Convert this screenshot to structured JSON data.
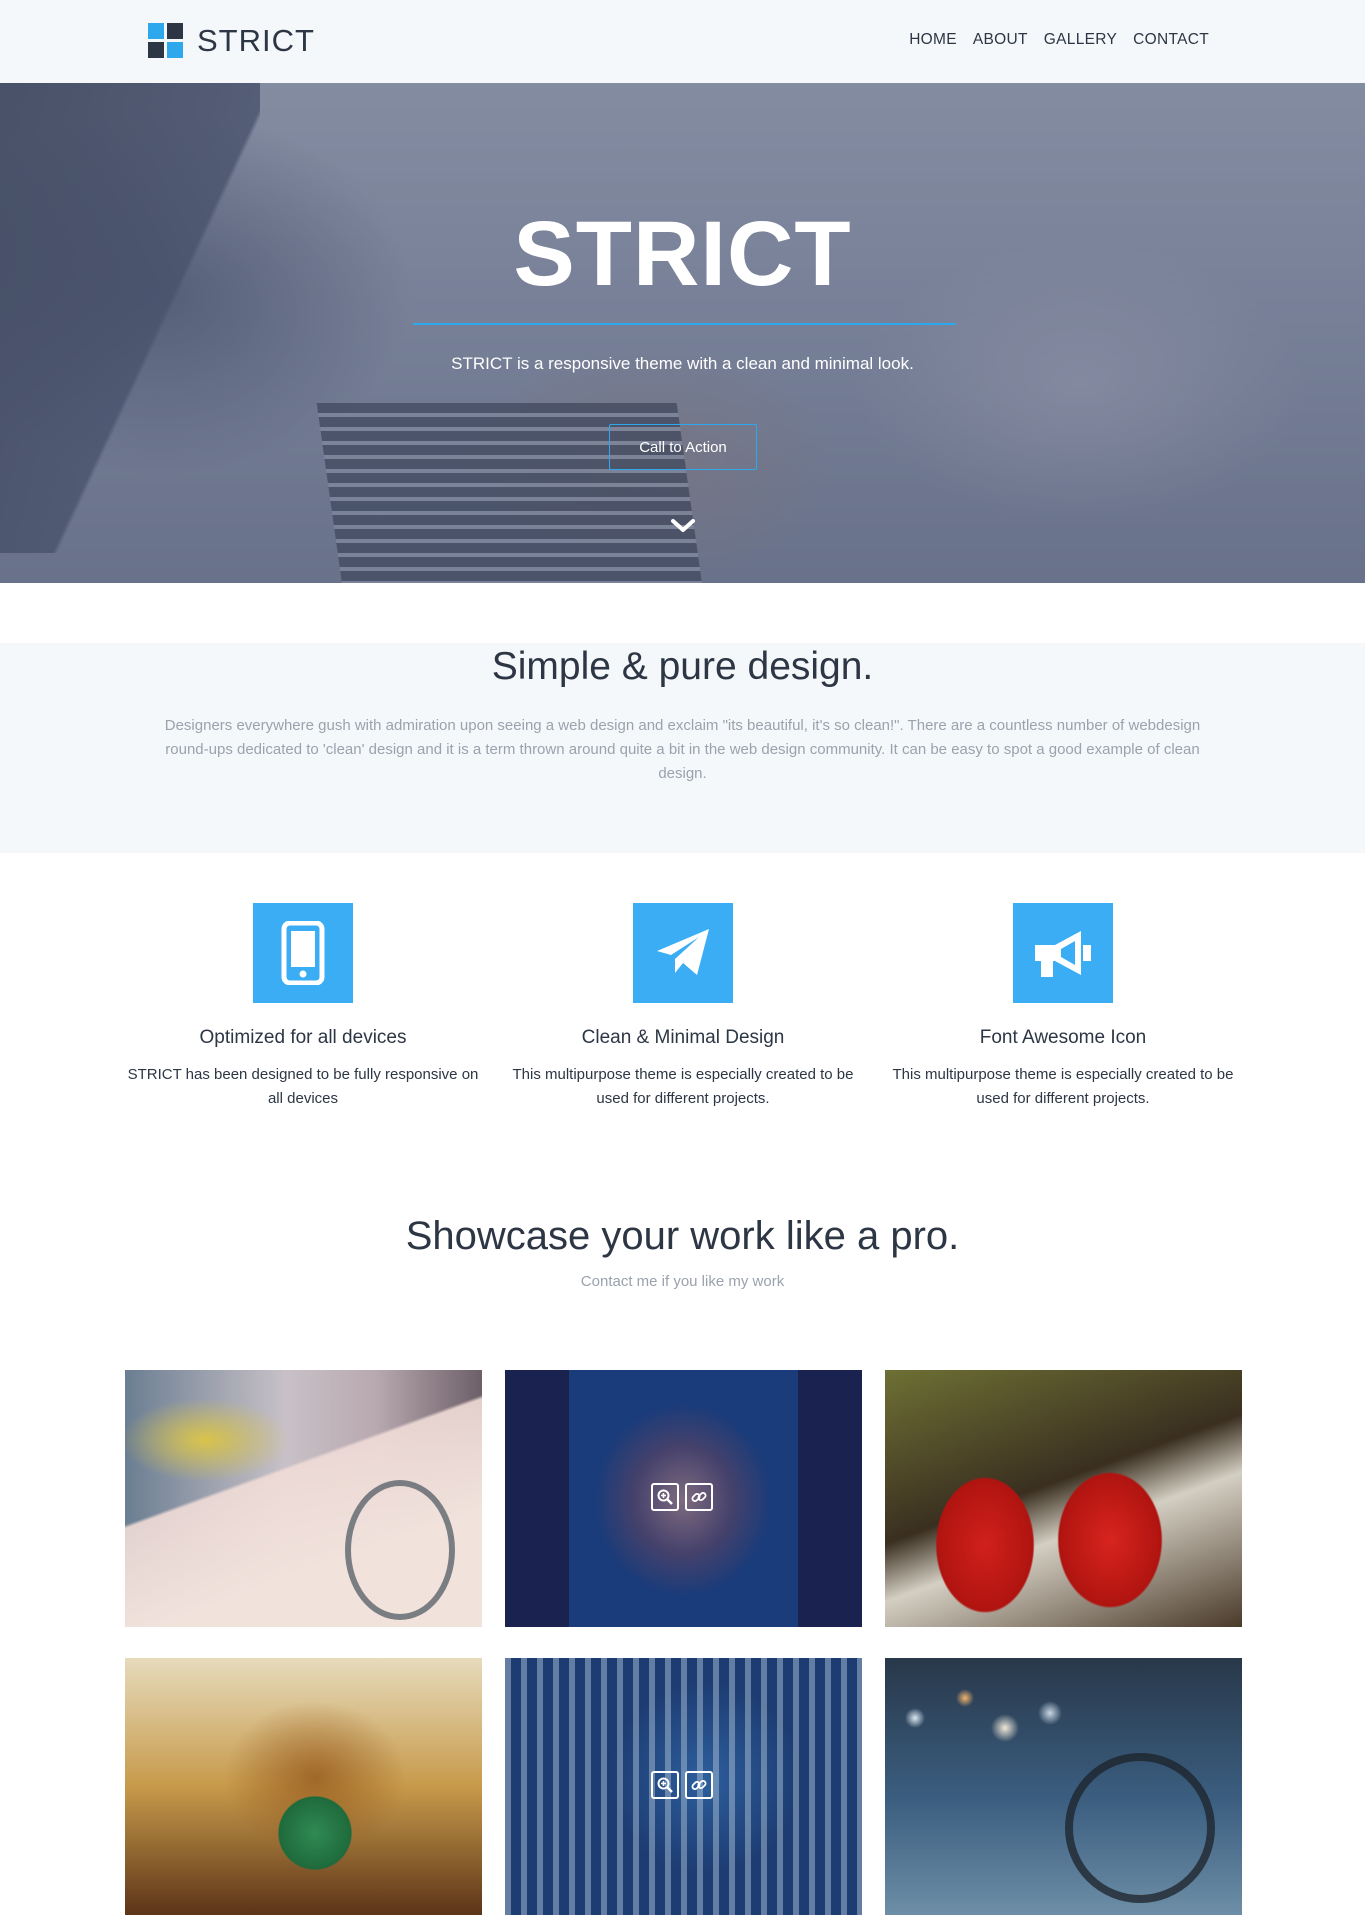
{
  "brand": {
    "name": "STRICT"
  },
  "nav": {
    "items": [
      {
        "label": "HOME"
      },
      {
        "label": "ABOUT"
      },
      {
        "label": "GALLERY"
      },
      {
        "label": "CONTACT"
      }
    ]
  },
  "hero": {
    "title": "STRICT",
    "subtitle": "STRICT is a responsive theme with a clean and minimal look.",
    "cta_label": "Call to Action"
  },
  "intro": {
    "heading": "Simple & pure design.",
    "body": "Designers everywhere gush with admiration upon seeing a web design and exclaim \"its beautiful, it's so clean!\". There are a countless number of webdesign round-ups dedicated to 'clean' design and it is a term thrown around quite a bit in the web design community. It can be easy to spot a good example of clean design."
  },
  "features": [
    {
      "icon": "mobile-phone-icon",
      "title": "Optimized for all devices",
      "text": "STRICT has been designed to be fully responsive on all devices"
    },
    {
      "icon": "paper-plane-icon",
      "title": "Clean & Minimal Design",
      "text": "This multipurpose theme is especially created to be used for different projects."
    },
    {
      "icon": "bullhorn-icon",
      "title": "Font Awesome Icon",
      "text": "This multipurpose theme is especially created to be used for different projects."
    }
  ],
  "showcase": {
    "heading": "Showcase your work like a pro.",
    "subheading": "Contact me if you like my work"
  },
  "colors": {
    "accent": "#2ea8ec",
    "dark": "#2d3644",
    "light_bg": "#f5f8fa",
    "muted_text": "#9aa2ad"
  }
}
